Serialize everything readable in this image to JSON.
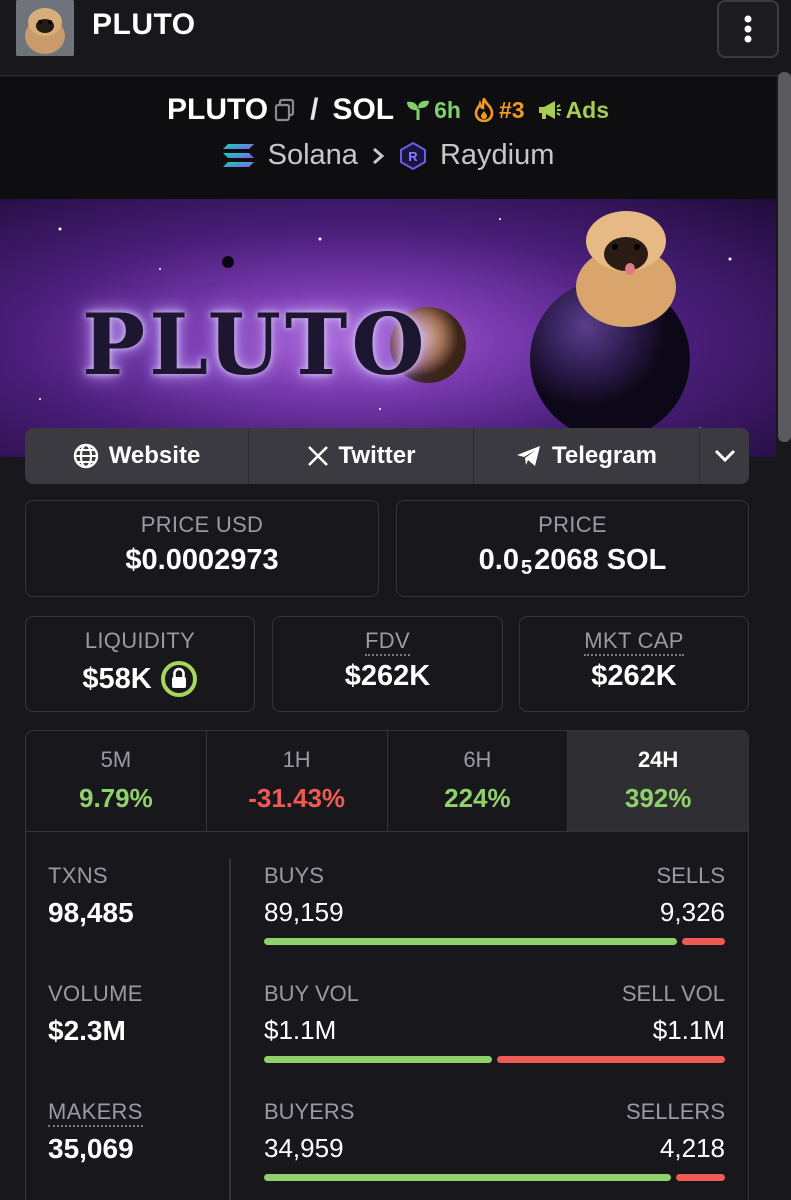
{
  "header": {
    "title": "PLUTO",
    "menu_icon": "vertical-ellipsis-icon"
  },
  "pair": {
    "base": "PLUTO",
    "separator": "/",
    "quote": "SOL",
    "age": "6h",
    "rank": "#3",
    "ads": "Ads",
    "chain": "Solana",
    "dex": "Raydium"
  },
  "banner": {
    "logo_text": "PLUTO"
  },
  "links": {
    "website": "Website",
    "twitter": "Twitter",
    "telegram": "Telegram"
  },
  "stats": {
    "price_usd_label": "PRICE USD",
    "price_usd": "$0.0002973",
    "price_label": "PRICE",
    "price_sol_pre": "0.0",
    "price_sol_sub": "5",
    "price_sol_post": "2068 SOL",
    "liquidity_label": "LIQUIDITY",
    "liquidity": "$58K",
    "fdv_label": "FDV",
    "fdv": "$262K",
    "mktcap_label": "MKT CAP",
    "mktcap": "$262K"
  },
  "changes": [
    {
      "period": "5M",
      "value": "9.79%"
    },
    {
      "period": "1H",
      "value": "-31.43%"
    },
    {
      "period": "6H",
      "value": "224%"
    },
    {
      "period": "24H",
      "value": "392%"
    }
  ],
  "txns": {
    "txns_label": "TXNS",
    "txns": "98,485",
    "volume_label": "VOLUME",
    "volume": "$2.3M",
    "makers_label": "MAKERS",
    "makers": "35,069",
    "buys_label": "BUYS",
    "buys": "89,159",
    "sells_label": "SELLS",
    "sells": "9,326",
    "buyvol_label": "BUY VOL",
    "buyvol": "$1.1M",
    "sellvol_label": "SELL VOL",
    "sellvol": "$1.1M",
    "buyers_label": "BUYERS",
    "buyers": "34,959",
    "sellers_label": "SELLERS",
    "sellers": "4,218",
    "buys_ratio": 0.905,
    "buyvol_ratio": 0.5,
    "buyers_ratio": 0.892
  },
  "colors": {
    "positive": "#8fd16a",
    "negative": "#f05a55",
    "age": "#7fd16a",
    "rank": "#f39a1c",
    "ads": "#a6cc52"
  }
}
